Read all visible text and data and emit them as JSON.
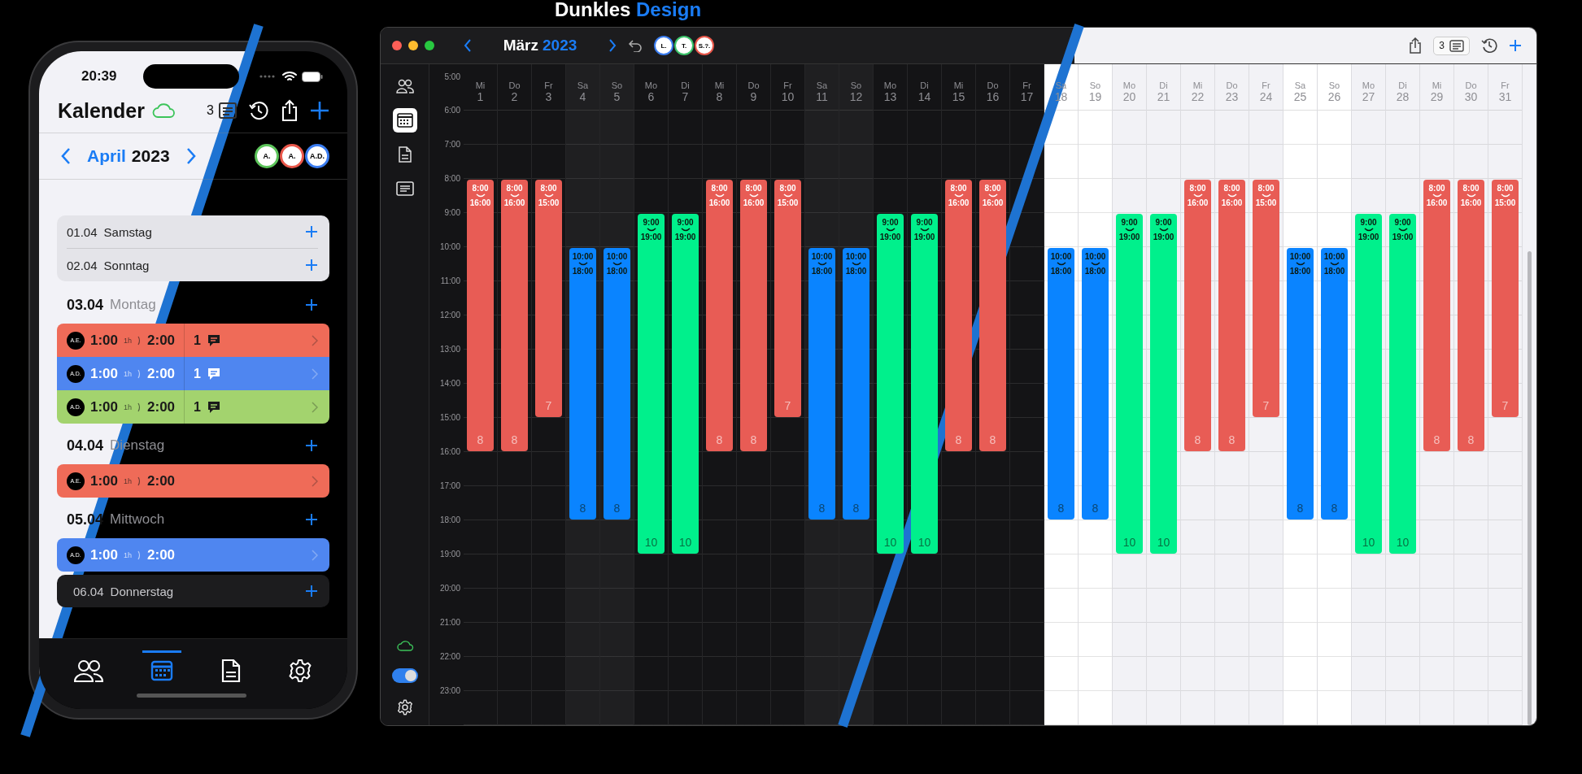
{
  "heading": {
    "plain": "Dunkles",
    "accent": "Design"
  },
  "phone": {
    "time": "20:39",
    "title": "Kalender",
    "doc_count": "3",
    "month": "April",
    "year": "2023",
    "avatars": [
      {
        "initials": "A.",
        "color": "#5cc45a"
      },
      {
        "initials": "A.",
        "color": "#e9574a"
      },
      {
        "initials": "A.D.",
        "color": "#3a7cf0"
      }
    ],
    "days": [
      {
        "kind": "group",
        "entries": [
          {
            "date": "01.04",
            "weekday": "Samstag"
          },
          {
            "date": "02.04",
            "weekday": "Sonntag"
          }
        ]
      },
      {
        "kind": "day",
        "date": "03.04",
        "weekday": "Montag",
        "shifts": [
          {
            "initials": "A.E.",
            "start": "1:00",
            "duration": "1h",
            "end": "2:00",
            "comments": "1",
            "color": "#ef6b58"
          },
          {
            "initials": "A.D.",
            "start": "1:00",
            "duration": "1h",
            "end": "2:00",
            "comments": "1",
            "color": "#4f86f0"
          },
          {
            "initials": "A.D.",
            "start": "1:00",
            "duration": "1h",
            "end": "2:00",
            "comments": "1",
            "color": "#a3d36e"
          }
        ]
      },
      {
        "kind": "day",
        "date": "04.04",
        "weekday": "Dienstag",
        "shifts": [
          {
            "initials": "A.E.",
            "start": "1:00",
            "duration": "1h",
            "end": "2:00",
            "color": "#ef6b58"
          }
        ]
      },
      {
        "kind": "day",
        "date": "05.04",
        "weekday": "Mittwoch",
        "shifts": [
          {
            "initials": "A.D.",
            "start": "1:00",
            "duration": "1h",
            "end": "2:00",
            "color": "#4f86f0"
          }
        ]
      },
      {
        "kind": "group",
        "entries": [
          {
            "date": "06.04",
            "weekday": "Donnerstag"
          }
        ]
      }
    ],
    "tabs": [
      {
        "kind": "people",
        "selected": false
      },
      {
        "kind": "calendar",
        "selected": true
      },
      {
        "kind": "document",
        "selected": false
      },
      {
        "kind": "settings",
        "selected": false
      }
    ]
  },
  "mac": {
    "month": "März",
    "year": "2023",
    "doc_count": "3",
    "sync_toggle": {
      "on": true
    },
    "avatars": [
      {
        "initials": "L.",
        "color": "#3a7cf0"
      },
      {
        "initials": "T.",
        "color": "#3cc46a"
      },
      {
        "initials": "S.?.",
        "color": "#e9574a"
      }
    ],
    "sidebar": [
      {
        "kind": "people",
        "selected": false
      },
      {
        "kind": "calendar",
        "selected": true
      },
      {
        "kind": "document",
        "selected": false
      },
      {
        "kind": "list",
        "selected": false
      }
    ],
    "hours": [
      "5:00",
      "6:00",
      "7:00",
      "8:00",
      "9:00",
      "10:00",
      "11:00",
      "12:00",
      "13:00",
      "14:00",
      "15:00",
      "16:00",
      "17:00",
      "18:00",
      "19:00",
      "20:00",
      "21:00",
      "22:00",
      "23:00"
    ],
    "days": [
      {
        "weekday": "Mi",
        "day": "1",
        "dark": true,
        "weekend": false,
        "shift": {
          "start": "8:00",
          "end": "16:00",
          "total": "8",
          "color": "#e85c55"
        }
      },
      {
        "weekday": "Do",
        "day": "2",
        "dark": true,
        "weekend": false,
        "shift": {
          "start": "8:00",
          "end": "16:00",
          "total": "8",
          "color": "#e85c55"
        }
      },
      {
        "weekday": "Fr",
        "day": "3",
        "dark": true,
        "weekend": false,
        "shift": {
          "start": "8:00",
          "end": "15:00",
          "total": "7",
          "color": "#e85c55"
        }
      },
      {
        "weekday": "Sa",
        "day": "4",
        "dark": true,
        "weekend": true,
        "shift": {
          "start": "10:00",
          "end": "18:00",
          "total": "8",
          "color": "#0a84ff"
        }
      },
      {
        "weekday": "So",
        "day": "5",
        "dark": true,
        "weekend": true,
        "shift": {
          "start": "10:00",
          "end": "18:00",
          "total": "8",
          "color": "#0a84ff"
        }
      },
      {
        "weekday": "Mo",
        "day": "6",
        "dark": true,
        "weekend": false,
        "shift": {
          "start": "9:00",
          "end": "19:00",
          "total": "10",
          "color": "#00f08c"
        }
      },
      {
        "weekday": "Di",
        "day": "7",
        "dark": true,
        "weekend": false,
        "shift": {
          "start": "9:00",
          "end": "19:00",
          "total": "10",
          "color": "#00f08c"
        }
      },
      {
        "weekday": "Mi",
        "day": "8",
        "dark": true,
        "weekend": false,
        "shift": {
          "start": "8:00",
          "end": "16:00",
          "total": "8",
          "color": "#e85c55"
        }
      },
      {
        "weekday": "Do",
        "day": "9",
        "dark": true,
        "weekend": false,
        "shift": {
          "start": "8:00",
          "end": "16:00",
          "total": "8",
          "color": "#e85c55"
        }
      },
      {
        "weekday": "Fr",
        "day": "10",
        "dark": true,
        "weekend": false,
        "shift": {
          "start": "8:00",
          "end": "15:00",
          "total": "7",
          "color": "#e85c55"
        }
      },
      {
        "weekday": "Sa",
        "day": "11",
        "dark": true,
        "weekend": true,
        "shift": {
          "start": "10:00",
          "end": "18:00",
          "total": "8",
          "color": "#0a84ff"
        }
      },
      {
        "weekday": "So",
        "day": "12",
        "dark": true,
        "weekend": true,
        "shift": {
          "start": "10:00",
          "end": "18:00",
          "total": "8",
          "color": "#0a84ff"
        }
      },
      {
        "weekday": "Mo",
        "day": "13",
        "dark": true,
        "weekend": false,
        "shift": {
          "start": "9:00",
          "end": "19:00",
          "total": "10",
          "color": "#00f08c"
        }
      },
      {
        "weekday": "Di",
        "day": "14",
        "dark": true,
        "weekend": false,
        "shift": {
          "start": "9:00",
          "end": "19:00",
          "total": "10",
          "color": "#00f08c"
        }
      },
      {
        "weekday": "Mi",
        "day": "15",
        "dark": true,
        "weekend": false,
        "shift": {
          "start": "8:00",
          "end": "16:00",
          "total": "8",
          "color": "#e85c55"
        }
      },
      {
        "weekday": "Do",
        "day": "16",
        "dark": true,
        "weekend": false,
        "shift": {
          "start": "8:00",
          "end": "16:00",
          "total": "8",
          "color": "#e85c55"
        }
      },
      {
        "weekday": "Fr",
        "day": "17",
        "dark": true,
        "weekend": false
      },
      {
        "weekday": "Sa",
        "day": "18",
        "dark": false,
        "weekend": true,
        "shift": {
          "start": "10:00",
          "end": "18:00",
          "total": "8",
          "color": "#0a84ff"
        }
      },
      {
        "weekday": "So",
        "day": "19",
        "dark": false,
        "weekend": true,
        "shift": {
          "start": "10:00",
          "end": "18:00",
          "total": "8",
          "color": "#0a84ff"
        }
      },
      {
        "weekday": "Mo",
        "day": "20",
        "dark": false,
        "weekend": false,
        "shift": {
          "start": "9:00",
          "end": "19:00",
          "total": "10",
          "color": "#00f08c"
        }
      },
      {
        "weekday": "Di",
        "day": "21",
        "dark": false,
        "weekend": false,
        "shift": {
          "start": "9:00",
          "end": "19:00",
          "total": "10",
          "color": "#00f08c"
        }
      },
      {
        "weekday": "Mi",
        "day": "22",
        "dark": false,
        "weekend": false,
        "shift": {
          "start": "8:00",
          "end": "16:00",
          "total": "8",
          "color": "#e85c55"
        }
      },
      {
        "weekday": "Do",
        "day": "23",
        "dark": false,
        "weekend": false,
        "shift": {
          "start": "8:00",
          "end": "16:00",
          "total": "8",
          "color": "#e85c55"
        }
      },
      {
        "weekday": "Fr",
        "day": "24",
        "dark": false,
        "weekend": false,
        "shift": {
          "start": "8:00",
          "end": "15:00",
          "total": "7",
          "color": "#e85c55"
        }
      },
      {
        "weekday": "Sa",
        "day": "25",
        "dark": false,
        "weekend": true,
        "shift": {
          "start": "10:00",
          "end": "18:00",
          "total": "8",
          "color": "#0a84ff"
        }
      },
      {
        "weekday": "So",
        "day": "26",
        "dark": false,
        "weekend": true,
        "shift": {
          "start": "10:00",
          "end": "18:00",
          "total": "8",
          "color": "#0a84ff"
        }
      },
      {
        "weekday": "Mo",
        "day": "27",
        "dark": false,
        "weekend": false,
        "shift": {
          "start": "9:00",
          "end": "19:00",
          "total": "10",
          "color": "#00f08c"
        }
      },
      {
        "weekday": "Di",
        "day": "28",
        "dark": false,
        "weekend": false,
        "shift": {
          "start": "9:00",
          "end": "19:00",
          "total": "10",
          "color": "#00f08c"
        }
      },
      {
        "weekday": "Mi",
        "day": "29",
        "dark": false,
        "weekend": false,
        "shift": {
          "start": "8:00",
          "end": "16:00",
          "total": "8",
          "color": "#e85c55"
        }
      },
      {
        "weekday": "Do",
        "day": "30",
        "dark": false,
        "weekend": false,
        "shift": {
          "start": "8:00",
          "end": "16:00",
          "total": "8",
          "color": "#e85c55"
        }
      },
      {
        "weekday": "Fr",
        "day": "31",
        "dark": false,
        "weekend": false,
        "shift": {
          "start": "8:00",
          "end": "15:00",
          "total": "7",
          "color": "#e85c55"
        }
      }
    ]
  }
}
